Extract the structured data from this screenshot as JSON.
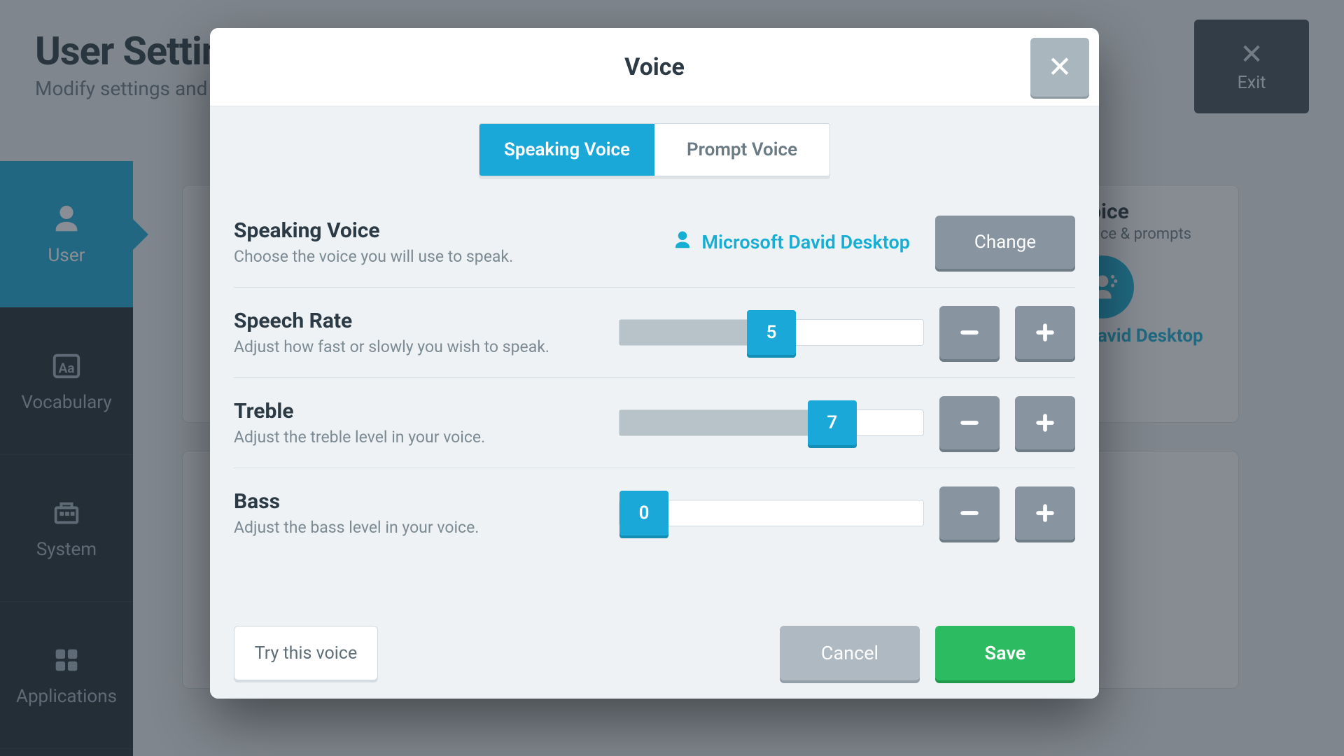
{
  "page": {
    "title": "User Settings",
    "subtitle": "Modify settings and preferences"
  },
  "exit": {
    "label": "Exit"
  },
  "sidebar": {
    "items": [
      {
        "label": "User"
      },
      {
        "label": "Vocabulary"
      },
      {
        "label": "System"
      },
      {
        "label": "Applications"
      }
    ]
  },
  "voice_tile": {
    "title": "Voice",
    "subtitle": "Speaking voice & prompts",
    "current": "Microsoft David Desktop"
  },
  "modal": {
    "title": "Voice",
    "tabs": {
      "speaking": "Speaking Voice",
      "prompt": "Prompt Voice"
    },
    "speaking_voice": {
      "heading": "Speaking Voice",
      "desc": "Choose the voice you will use to speak.",
      "current": "Microsoft David Desktop",
      "change": "Change"
    },
    "speech_rate": {
      "heading": "Speech Rate",
      "desc": "Adjust how fast or slowly you wish to speak.",
      "value": "5",
      "min": 0,
      "max": 10
    },
    "treble": {
      "heading": "Treble",
      "desc": "Adjust the treble level in your voice.",
      "value": "7",
      "min": 0,
      "max": 10
    },
    "bass": {
      "heading": "Bass",
      "desc": "Adjust the bass level in your voice.",
      "value": "0",
      "min": 0,
      "max": 10
    },
    "footer": {
      "try": "Try this voice",
      "cancel": "Cancel",
      "save": "Save"
    }
  }
}
